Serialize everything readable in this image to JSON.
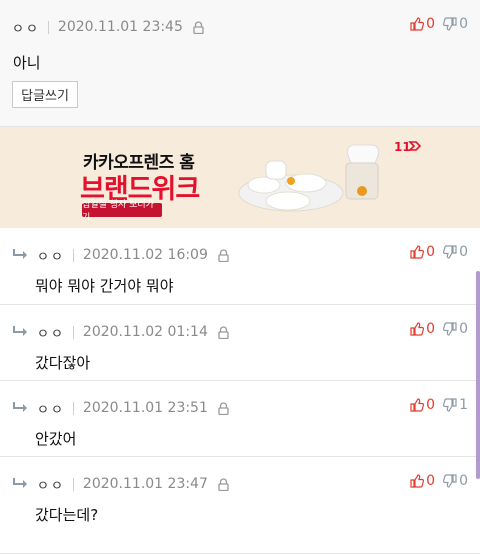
{
  "comments_top": {
    "author": "ㅇㅇ",
    "date": "2020.11.01 23:45",
    "text": "아니",
    "up": "0",
    "down": "0",
    "reply_button": "답글쓰기"
  },
  "ad": {
    "line1": "카카오프렌즈 홈",
    "line2": "브랜드위크",
    "button": "십일절 행사 보러가기",
    "logo": "11",
    "colors": {
      "background": "#f7ecdb",
      "accent": "#e3102e"
    }
  },
  "replies": [
    {
      "author": "ㅇㅇ",
      "date": "2020.11.02 16:09",
      "text": "뭐야 뭐야 간거야 뭐야",
      "up": "0",
      "down": "0"
    },
    {
      "author": "ㅇㅇ",
      "date": "2020.11.02 01:14",
      "text": "갔다잖아",
      "up": "0",
      "down": "0"
    },
    {
      "author": "ㅇㅇ",
      "date": "2020.11.01 23:51",
      "text": "안갔어",
      "up": "0",
      "down": "1"
    },
    {
      "author": "ㅇㅇ",
      "date": "2020.11.01 23:47",
      "text": "갔다는데?",
      "up": "0",
      "down": "0"
    }
  ],
  "icons": {
    "reply_arrow": "reply-arrow-icon",
    "lock": "lock-icon",
    "thumb_up": "thumb-up-icon",
    "thumb_down": "thumb-down-icon"
  },
  "colors": {
    "upvote": "#e43b2f",
    "downvote": "#8e9aa6",
    "date": "#8a8a8a"
  }
}
